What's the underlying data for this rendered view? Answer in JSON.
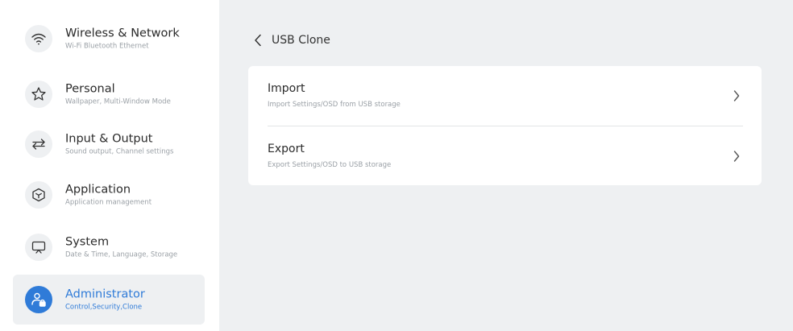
{
  "sidebar": {
    "items": [
      {
        "title": "Wireless & Network",
        "subtitle": "Wi-Fi Bluetooth Ethernet",
        "icon": "wifi-icon"
      },
      {
        "title": "Personal",
        "subtitle": "Wallpaper, Multi-Window Mode",
        "icon": "star-icon"
      },
      {
        "title": "Input & Output",
        "subtitle": "Sound output, Channel settings",
        "icon": "swap-arrows-icon"
      },
      {
        "title": "Application",
        "subtitle": "Application management",
        "icon": "cube-icon"
      },
      {
        "title": "System",
        "subtitle": "Date & Time, Language, Storage",
        "icon": "monitor-icon"
      },
      {
        "title": "Administrator",
        "subtitle": "Control,Security,Clone",
        "icon": "admin-user-lock-icon",
        "selected": true
      }
    ]
  },
  "main": {
    "title": "USB Clone",
    "back_icon": "chevron-left-icon",
    "rows": [
      {
        "title": "Import",
        "subtitle": "Import Settings/OSD from USB storage",
        "icon": "chevron-right-icon"
      },
      {
        "title": "Export",
        "subtitle": "Export Settings/OSD to USB storage",
        "icon": "chevron-right-icon"
      }
    ]
  },
  "colors": {
    "accent": "#2f7bd8",
    "content_bg": "#eef0f2",
    "card_bg": "#ffffff",
    "selected_bg": "#eef0f2"
  }
}
